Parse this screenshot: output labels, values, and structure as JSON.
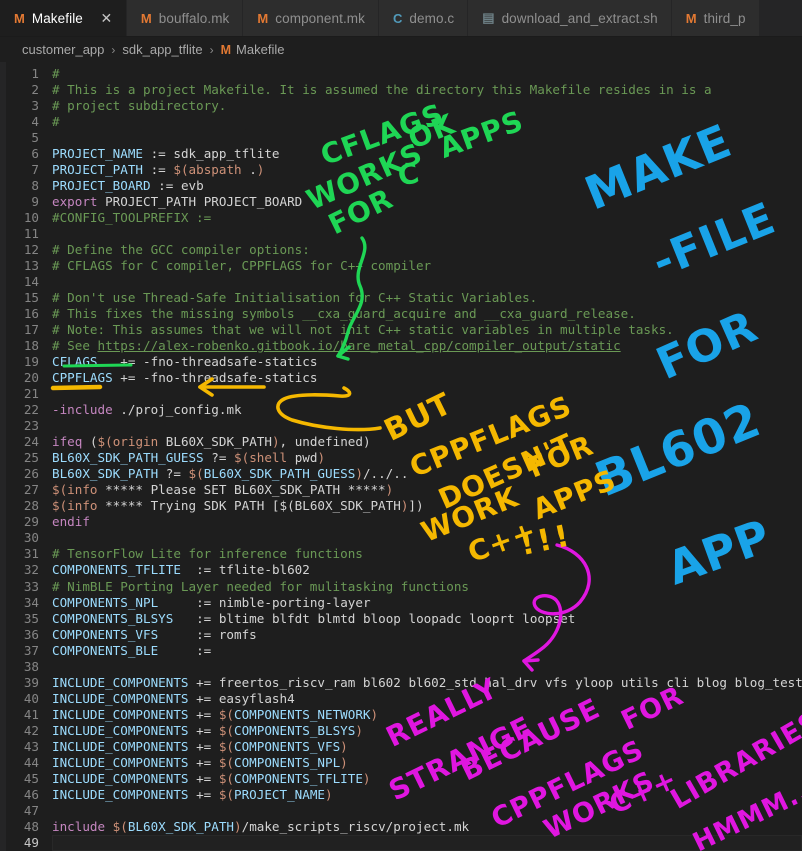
{
  "window": {
    "kind": "code-editor",
    "theme": "dark"
  },
  "tabs": [
    {
      "label": "Makefile",
      "icon": "makefile-icon",
      "icon_glyph": "M",
      "active": true,
      "closable": true,
      "close_glyph": "✕"
    },
    {
      "label": "bouffalo.mk",
      "icon": "makefile-icon",
      "icon_glyph": "M",
      "active": false,
      "closable": false
    },
    {
      "label": "component.mk",
      "icon": "makefile-icon",
      "icon_glyph": "M",
      "active": false,
      "closable": false
    },
    {
      "label": "demo.c",
      "icon": "c-file-icon",
      "icon_glyph": "C",
      "active": false,
      "closable": false
    },
    {
      "label": "download_and_extract.sh",
      "icon": "shell-file-icon",
      "icon_glyph": "▤",
      "active": false,
      "closable": false
    },
    {
      "label": "third_p",
      "icon": "makefile-icon",
      "icon_glyph": "M",
      "active": false,
      "closable": false
    }
  ],
  "breadcrumb": {
    "parts": [
      "customer_app",
      "sdk_app_tflite",
      "Makefile"
    ],
    "separator": "›",
    "file_icon_glyph": "M"
  },
  "editor": {
    "current_line": 49,
    "total_lines": 49,
    "lines": [
      {
        "n": 1,
        "t": "#"
      },
      {
        "n": 2,
        "t": "# This is a project Makefile. It is assumed the directory this Makefile resides in is a"
      },
      {
        "n": 3,
        "t": "# project subdirectory."
      },
      {
        "n": 4,
        "t": "#"
      },
      {
        "n": 5,
        "t": ""
      },
      {
        "n": 6,
        "t": "PROJECT_NAME := sdk_app_tflite"
      },
      {
        "n": 7,
        "t": "PROJECT_PATH := $(abspath .)"
      },
      {
        "n": 8,
        "t": "PROJECT_BOARD := evb"
      },
      {
        "n": 9,
        "t": "export PROJECT_PATH PROJECT_BOARD"
      },
      {
        "n": 10,
        "t": "#CONFIG_TOOLPREFIX :="
      },
      {
        "n": 11,
        "t": ""
      },
      {
        "n": 12,
        "t": "# Define the GCC compiler options:"
      },
      {
        "n": 13,
        "t": "# CFLAGS for C compiler, CPPFLAGS for C++ compiler"
      },
      {
        "n": 14,
        "t": ""
      },
      {
        "n": 15,
        "t": "# Don't use Thread-Safe Initialisation for C++ Static Variables."
      },
      {
        "n": 16,
        "t": "# This fixes the missing symbols __cxa_guard_acquire and __cxa_guard_release."
      },
      {
        "n": 17,
        "t": "# Note: This assumes that we will not init C++ static variables in multiple tasks."
      },
      {
        "n": 18,
        "t": "# See https://alex-robenko.gitbook.io/bare_metal_cpp/compiler_output/static"
      },
      {
        "n": 19,
        "t": "CFLAGS   += -fno-threadsafe-statics"
      },
      {
        "n": 20,
        "t": "CPPFLAGS += -fno-threadsafe-statics"
      },
      {
        "n": 21,
        "t": ""
      },
      {
        "n": 22,
        "t": "-include ./proj_config.mk"
      },
      {
        "n": 23,
        "t": ""
      },
      {
        "n": 24,
        "t": "ifeq ($(origin BL60X_SDK_PATH), undefined)"
      },
      {
        "n": 25,
        "t": "BL60X_SDK_PATH_GUESS ?= $(shell pwd)"
      },
      {
        "n": 26,
        "t": "BL60X_SDK_PATH ?= $(BL60X_SDK_PATH_GUESS)/../.."
      },
      {
        "n": 27,
        "t": "$(info ***** Please SET BL60X_SDK_PATH *****)"
      },
      {
        "n": 28,
        "t": "$(info ***** Trying SDK PATH [$(BL60X_SDK_PATH)])"
      },
      {
        "n": 29,
        "t": "endif"
      },
      {
        "n": 30,
        "t": ""
      },
      {
        "n": 31,
        "t": "# TensorFlow Lite for inference functions"
      },
      {
        "n": 32,
        "t": "COMPONENTS_TFLITE  := tflite-bl602"
      },
      {
        "n": 33,
        "t": "# NimBLE Porting Layer needed for mulitasking functions"
      },
      {
        "n": 34,
        "t": "COMPONENTS_NPL     := nimble-porting-layer"
      },
      {
        "n": 35,
        "t": "COMPONENTS_BLSYS   := bltime blfdt blmtd bloop loopadc looprt loopset"
      },
      {
        "n": 36,
        "t": "COMPONENTS_VFS     := romfs"
      },
      {
        "n": 37,
        "t": "COMPONENTS_BLE     :="
      },
      {
        "n": 38,
        "t": ""
      },
      {
        "n": 39,
        "t": "INCLUDE_COMPONENTS += freertos_riscv_ram bl602 bl602_std hal_drv vfs yloop utils cli blog blog_testc"
      },
      {
        "n": 40,
        "t": "INCLUDE_COMPONENTS += easyflash4"
      },
      {
        "n": 41,
        "t": "INCLUDE_COMPONENTS += $(COMPONENTS_NETWORK)"
      },
      {
        "n": 42,
        "t": "INCLUDE_COMPONENTS += $(COMPONENTS_BLSYS)"
      },
      {
        "n": 43,
        "t": "INCLUDE_COMPONENTS += $(COMPONENTS_VFS)"
      },
      {
        "n": 44,
        "t": "INCLUDE_COMPONENTS += $(COMPONENTS_NPL)"
      },
      {
        "n": 45,
        "t": "INCLUDE_COMPONENTS += $(COMPONENTS_TFLITE)"
      },
      {
        "n": 46,
        "t": "INCLUDE_COMPONENTS += $(PROJECT_NAME)"
      },
      {
        "n": 47,
        "t": ""
      },
      {
        "n": 48,
        "t": "include $(BL60X_SDK_PATH)/make_scripts_riscv/project.mk"
      },
      {
        "n": 49,
        "t": ""
      }
    ]
  },
  "annotations": {
    "colors": {
      "green": "#1fd655",
      "blue": "#19a3e8",
      "orange": "#f5b800",
      "magenta": "#e016e0"
    },
    "green_note": {
      "words": [
        "CFLAGS",
        "WORKS",
        "OK",
        "FOR",
        "C",
        "APPS"
      ],
      "full_text": "CFLAGS WORKS OK FOR C APPS"
    },
    "blue_note": {
      "words": [
        "MAKE",
        "-FILE",
        "FOR",
        "BL602",
        "APP"
      ],
      "full_text": "MAKE-FILE FOR BL602 APP"
    },
    "orange_note": {
      "words": [
        "BUT",
        "CPPFLAGS",
        "DOESN'T",
        "WORK",
        "FOR",
        "C++",
        "APPS",
        "!!!"
      ],
      "full_text": "BUT CPPFLAGS DOESN'T WORK FOR C++ APPS !!!"
    },
    "magenta_note": {
      "words": [
        "REALLY",
        "STRANGE",
        "BECAUSE",
        "CPPFLAGS",
        "WORKS",
        "FOR",
        "C++",
        "LIBRARIES",
        "HMMM..."
      ],
      "full_text": "REALLY STRANGE BECAUSE CPPFLAGS WORKS FOR C++ LIBRARIES HMMM..."
    },
    "underlines": [
      {
        "target_line": 19,
        "color": "green"
      },
      {
        "target_line": 21,
        "color": "orange"
      }
    ]
  }
}
